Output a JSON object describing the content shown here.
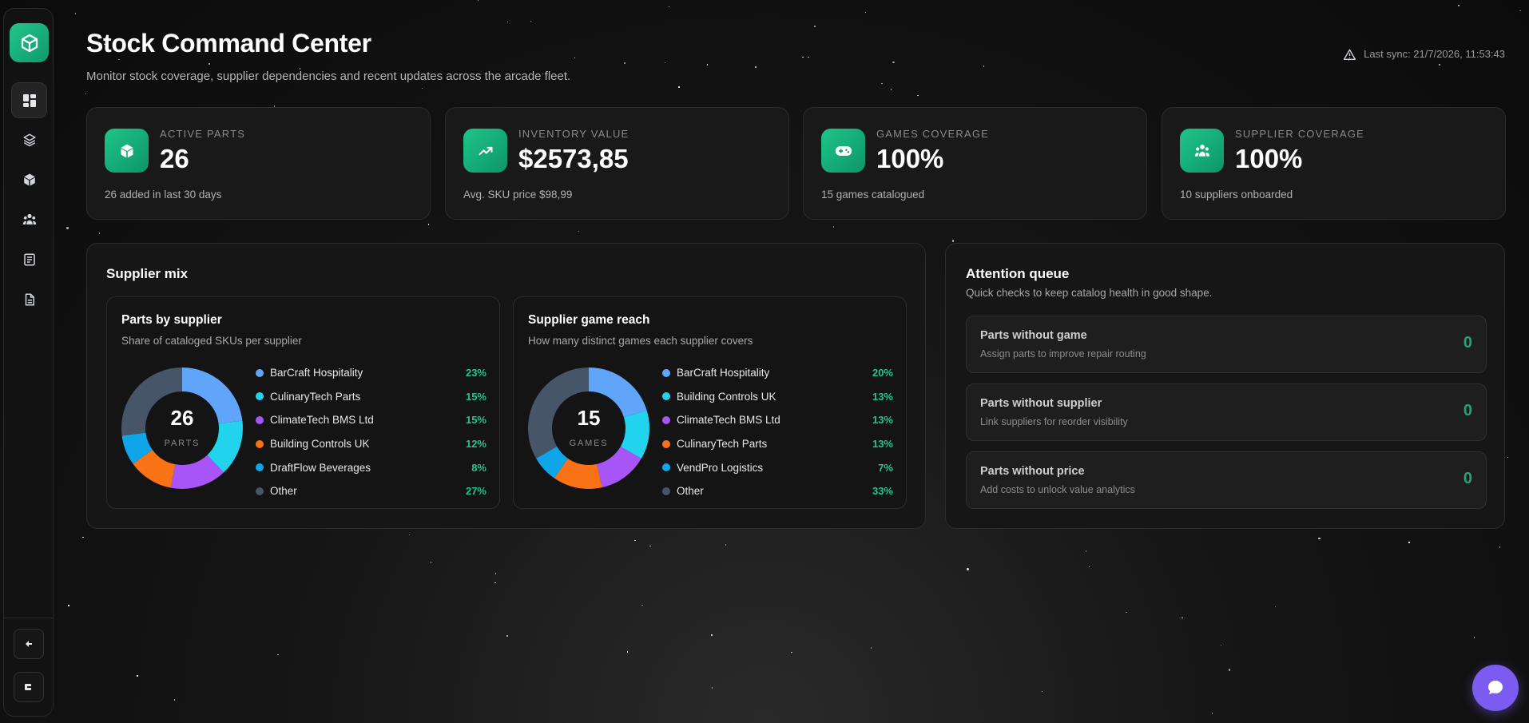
{
  "header": {
    "title": "Stock Command Center",
    "subtitle": "Monitor stock coverage, supplier dependencies and recent updates across the arcade fleet.",
    "last_sync": "Last sync: 21/7/2026, 11:53:43"
  },
  "sidebar": {
    "logo_icon": "cube-icon",
    "items": [
      {
        "icon": "dashboard-icon",
        "active": true
      },
      {
        "icon": "layers-icon",
        "active": false
      },
      {
        "icon": "cube-icon",
        "active": false
      },
      {
        "icon": "users-icon",
        "active": false
      },
      {
        "icon": "document-list-icon",
        "active": false
      },
      {
        "icon": "document-icon",
        "active": false
      }
    ],
    "bottom": [
      {
        "icon": "collapse-icon"
      },
      {
        "icon": "logout-icon"
      }
    ]
  },
  "stats": [
    {
      "label": "ACTIVE PARTS",
      "value": "26",
      "note": "26 added in last 30 days",
      "icon": "cube-icon"
    },
    {
      "label": "INVENTORY VALUE",
      "value": "$2573,85",
      "note": "Avg. SKU price $98,99",
      "icon": "trend-up-icon"
    },
    {
      "label": "GAMES COVERAGE",
      "value": "100%",
      "note": "15 games catalogued",
      "icon": "gamepad-icon"
    },
    {
      "label": "SUPPLIER COVERAGE",
      "value": "100%",
      "note": "10 suppliers onboarded",
      "icon": "users-icon"
    }
  ],
  "supplier_mix": {
    "title": "Supplier mix",
    "parts_by_supplier": {
      "title": "Parts by supplier",
      "subtitle": "Share of cataloged SKUs per supplier",
      "center_value": "26",
      "center_label": "PARTS",
      "legend": [
        {
          "name": "BarCraft Hospitality",
          "pct": "23%",
          "color": "#60a5fa"
        },
        {
          "name": "CulinaryTech Parts",
          "pct": "15%",
          "color": "#22d3ee"
        },
        {
          "name": "ClimateTech BMS Ltd",
          "pct": "15%",
          "color": "#a855f7"
        },
        {
          "name": "Building Controls UK",
          "pct": "12%",
          "color": "#f97316"
        },
        {
          "name": "DraftFlow Beverages",
          "pct": "8%",
          "color": "#0ea5e9"
        },
        {
          "name": "Other",
          "pct": "27%",
          "color": "#475569"
        }
      ]
    },
    "game_reach": {
      "title": "Supplier game reach",
      "subtitle": "How many distinct games each supplier covers",
      "center_value": "15",
      "center_label": "GAMES",
      "legend": [
        {
          "name": "BarCraft Hospitality",
          "pct": "20%",
          "color": "#60a5fa"
        },
        {
          "name": "Building Controls UK",
          "pct": "13%",
          "color": "#22d3ee"
        },
        {
          "name": "ClimateTech BMS Ltd",
          "pct": "13%",
          "color": "#a855f7"
        },
        {
          "name": "CulinaryTech Parts",
          "pct": "13%",
          "color": "#f97316"
        },
        {
          "name": "VendPro Logistics",
          "pct": "7%",
          "color": "#0ea5e9"
        },
        {
          "name": "Other",
          "pct": "33%",
          "color": "#475569"
        }
      ]
    }
  },
  "attention": {
    "title": "Attention queue",
    "subtitle": "Quick checks to keep catalog health in good shape.",
    "items": [
      {
        "title": "Parts without game",
        "subtitle": "Assign parts to improve repair routing",
        "count": "0"
      },
      {
        "title": "Parts without supplier",
        "subtitle": "Link suppliers for reorder visibility",
        "count": "0"
      },
      {
        "title": "Parts without price",
        "subtitle": "Add costs to unlock value analytics",
        "count": "0"
      }
    ]
  },
  "chat": {
    "icon": "chat-bubble-icon"
  },
  "colors": {
    "accent": "#22c58b",
    "chat": "#7c5cf0"
  }
}
